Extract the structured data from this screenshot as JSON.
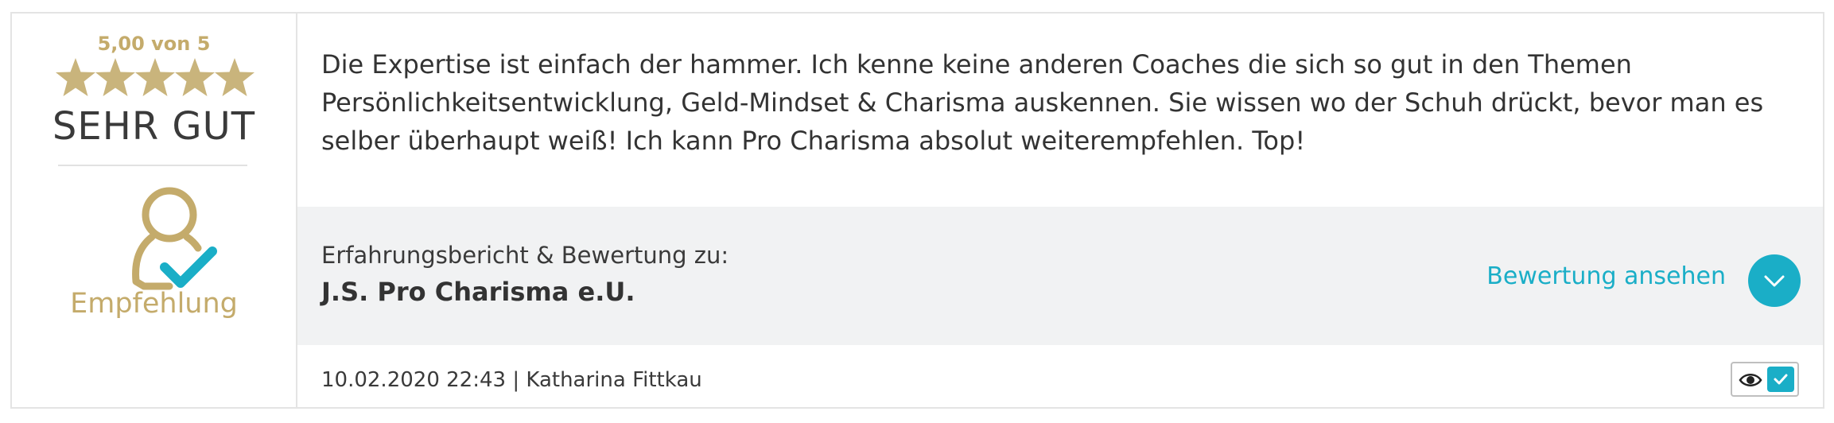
{
  "rating": {
    "score_text": "5,00 von 5",
    "stars": 5,
    "label": "SEHR GUT",
    "star_color": "#c9b47c"
  },
  "recommendation": {
    "icon": "user-check-icon",
    "label": "Empfehlung"
  },
  "review": {
    "text": "Die Expertise ist einfach der hammer. Ich kenne keine anderen Coaches die sich so gut in den Themen Persönlichkeitsentwicklung, Geld-Mindset & Charisma auskennen. Sie wissen wo der Schuh drückt, bevor man es selber überhaupt weiß! Ich kann Pro Charisma absolut weiterempfehlen. Top!"
  },
  "reference": {
    "caption": "Erfahrungsbericht & Bewertung zu:",
    "company": "J.S. Pro Charisma e.U.",
    "view_label": "Bewertung ansehen"
  },
  "footer": {
    "meta": "10.02.2020 22:43 | Katharina Fittkau"
  },
  "colors": {
    "accent": "#1aaec7",
    "gold": "#c4ab6b"
  }
}
